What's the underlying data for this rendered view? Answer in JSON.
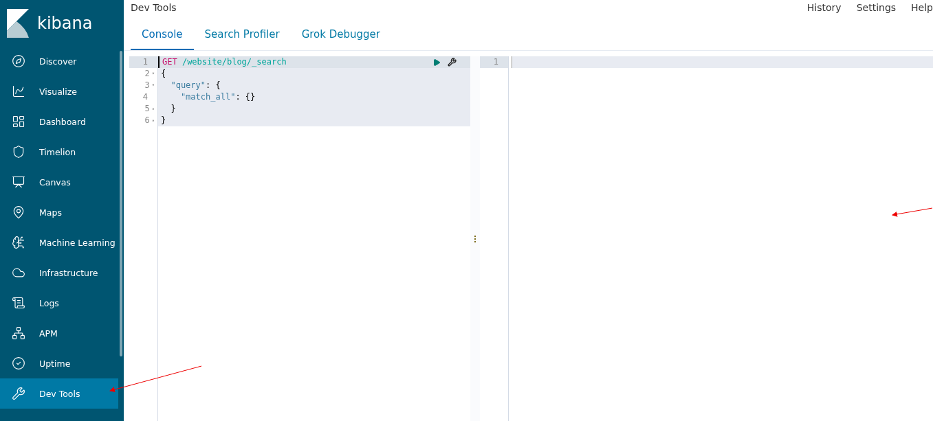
{
  "brand": {
    "name": "kibana"
  },
  "sidebar": {
    "items": [
      {
        "label": "Discover",
        "selected": false
      },
      {
        "label": "Visualize",
        "selected": false
      },
      {
        "label": "Dashboard",
        "selected": false
      },
      {
        "label": "Timelion",
        "selected": false
      },
      {
        "label": "Canvas",
        "selected": false
      },
      {
        "label": "Maps",
        "selected": false
      },
      {
        "label": "Machine Learning",
        "selected": false
      },
      {
        "label": "Infrastructure",
        "selected": false
      },
      {
        "label": "Logs",
        "selected": false
      },
      {
        "label": "APM",
        "selected": false
      },
      {
        "label": "Uptime",
        "selected": false
      },
      {
        "label": "Dev Tools",
        "selected": true
      }
    ]
  },
  "header": {
    "title": "Dev Tools",
    "links": [
      "History",
      "Settings",
      "Help"
    ]
  },
  "tabs": [
    {
      "label": "Console",
      "selected": true
    },
    {
      "label": "Search Profiler",
      "selected": false
    },
    {
      "label": "Grok Debugger",
      "selected": false
    }
  ],
  "request_editor": {
    "lines": [
      {
        "number": "1",
        "active": true,
        "tokens": [
          {
            "kind": "method",
            "text": "GET"
          },
          {
            "kind": "url",
            "text": " /website/blog/_search"
          }
        ]
      },
      {
        "number": "2",
        "fold": "▾",
        "active": false,
        "tokens": [
          {
            "kind": "punct",
            "text": "{"
          }
        ]
      },
      {
        "number": "3",
        "fold": "▾",
        "active": false,
        "tokens": [
          {
            "kind": "key",
            "text": "  \"query\""
          },
          {
            "kind": "punct",
            "text": ": {"
          }
        ]
      },
      {
        "number": "4",
        "active": false,
        "tokens": [
          {
            "kind": "key",
            "text": "    \"match_all\""
          },
          {
            "kind": "punct",
            "text": ": {}"
          }
        ]
      },
      {
        "number": "5",
        "fold": "▴",
        "active": false,
        "tokens": [
          {
            "kind": "punct",
            "text": "  }"
          }
        ]
      },
      {
        "number": "6",
        "fold": "▴",
        "active": false,
        "tokens": [
          {
            "kind": "punct",
            "text": "}"
          }
        ]
      }
    ]
  },
  "response_editor": {
    "lines": [
      {
        "number": "1",
        "active": true
      }
    ]
  }
}
